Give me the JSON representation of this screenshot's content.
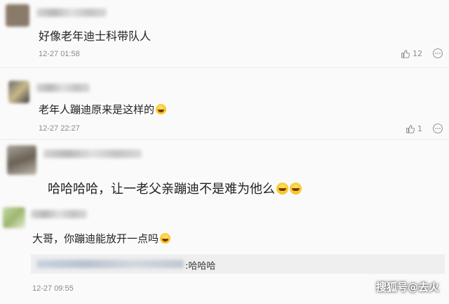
{
  "comments": [
    {
      "text": "好像老年迪士科带队人",
      "time": "12-27 01:58",
      "likes": "12"
    },
    {
      "text": "老年人蹦迪原来是这样的",
      "time": "12-27 22:27",
      "likes": "1"
    },
    {
      "text": "哈哈哈哈，让一老父亲蹦迪不是难为他么"
    },
    {
      "text": "大哥，你蹦迪能放开一点吗",
      "reply_text": ":哈哈哈",
      "time": "12-27 09:55"
    }
  ],
  "watermark": "搜狐号@去火",
  "icons": {
    "like": "thumbs-up-icon",
    "more": "more-dots-icon",
    "emoji": "laugh-emoji-icon"
  }
}
